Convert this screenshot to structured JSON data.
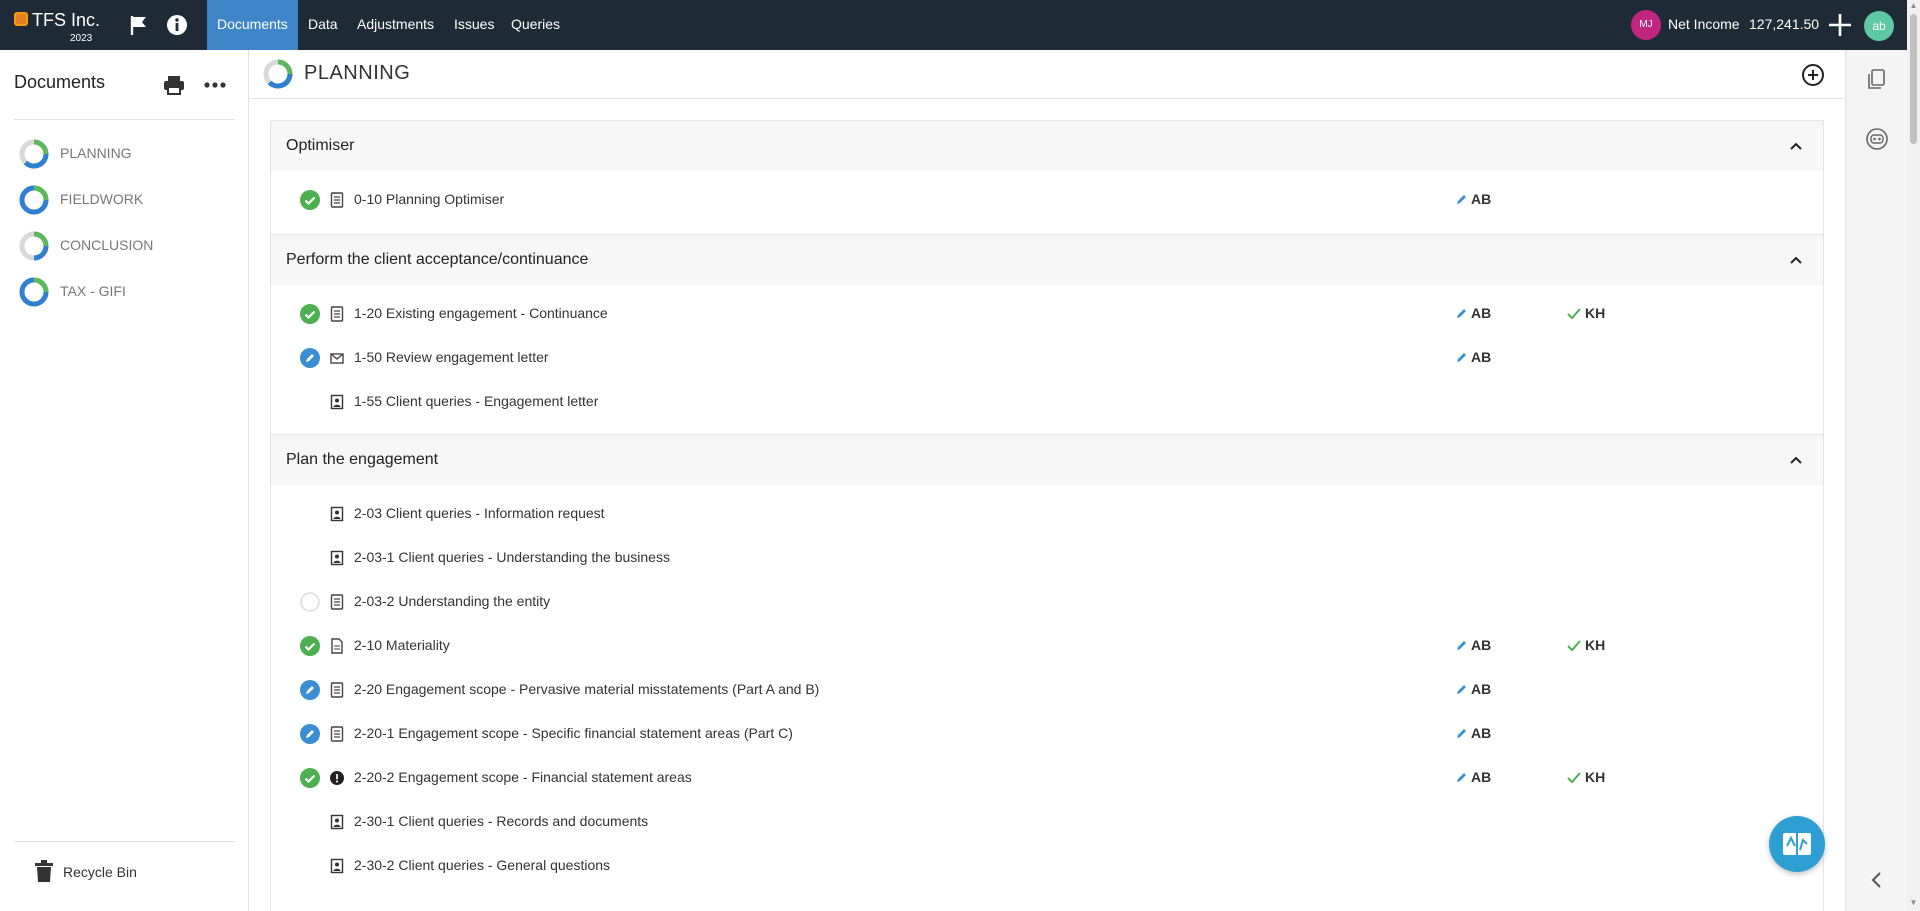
{
  "topbar": {
    "company": "TFS Inc.",
    "year": "2023",
    "tabs": [
      {
        "label": "Documents",
        "active": true
      },
      {
        "label": "Data"
      },
      {
        "label": "Adjustments"
      },
      {
        "label": "Issues"
      },
      {
        "label": "Queries"
      }
    ],
    "user_initials": "MJ",
    "net_income_label": "Net Income",
    "net_income_value": "127,241.50",
    "account_initials": "ab"
  },
  "sidebar": {
    "title": "Documents",
    "items": [
      {
        "label": "PLANNING"
      },
      {
        "label": "FIELDWORK"
      },
      {
        "label": "CONCLUSION"
      },
      {
        "label": "TAX - GIFI"
      }
    ],
    "recycle_label": "Recycle Bin"
  },
  "page": {
    "title": "PLANNING",
    "sections": [
      {
        "title": "Optimiser",
        "rows": [
          {
            "name": "0-10 Planning Optimiser",
            "status": "complete",
            "doc_icon": "checklist-icon",
            "preparer": "AB",
            "reviewer": ""
          }
        ]
      },
      {
        "title": "Perform the client acceptance/continuance",
        "rows": [
          {
            "name": "1-20 Existing engagement - Continuance",
            "status": "complete",
            "doc_icon": "checklist-icon",
            "preparer": "AB",
            "reviewer": "KH"
          },
          {
            "name": "1-50 Review engagement letter",
            "status": "in-progress",
            "doc_icon": "letter-icon",
            "preparer": "AB",
            "reviewer": ""
          },
          {
            "name": "1-55 Client queries - Engagement letter",
            "status": "none",
            "doc_icon": "client-query-icon",
            "preparer": "",
            "reviewer": ""
          }
        ]
      },
      {
        "title": "Plan the engagement",
        "rows": [
          {
            "name": "2-03 Client queries - Information request",
            "status": "none",
            "doc_icon": "client-query-icon",
            "preparer": "",
            "reviewer": ""
          },
          {
            "name": "2-03-1 Client queries - Understanding the business",
            "status": "none",
            "doc_icon": "client-query-icon",
            "preparer": "",
            "reviewer": ""
          },
          {
            "name": "2-03-2 Understanding the entity",
            "status": "not-started",
            "doc_icon": "checklist-icon",
            "preparer": "",
            "reviewer": ""
          },
          {
            "name": "2-10 Materiality",
            "status": "complete",
            "doc_icon": "document-icon",
            "preparer": "AB",
            "reviewer": "KH"
          },
          {
            "name": "2-20 Engagement scope - Pervasive material misstatements (Part A and B)",
            "status": "in-progress",
            "doc_icon": "checklist-icon",
            "preparer": "AB",
            "reviewer": ""
          },
          {
            "name": "2-20-1 Engagement scope - Specific financial statement areas (Part C)",
            "status": "in-progress",
            "doc_icon": "checklist-icon",
            "preparer": "AB",
            "reviewer": ""
          },
          {
            "name": "2-20-2 Engagement scope - Financial statement areas",
            "status": "complete",
            "doc_icon": "alert-icon",
            "preparer": "AB",
            "reviewer": "KH"
          },
          {
            "name": "2-30-1 Client queries - Records and documents",
            "status": "none",
            "doc_icon": "client-query-icon",
            "preparer": "",
            "reviewer": ""
          },
          {
            "name": "2-30-2 Client queries - General questions",
            "status": "none",
            "doc_icon": "client-query-icon",
            "preparer": "",
            "reviewer": ""
          }
        ]
      }
    ]
  },
  "colors": {
    "topbar_bg": "#1f2a37",
    "active_tab": "#3f86c9",
    "complete": "#4caf50",
    "in_progress": "#3a8fd4",
    "ring_blue": "#2f80d1",
    "ring_green": "#5cb85c"
  }
}
